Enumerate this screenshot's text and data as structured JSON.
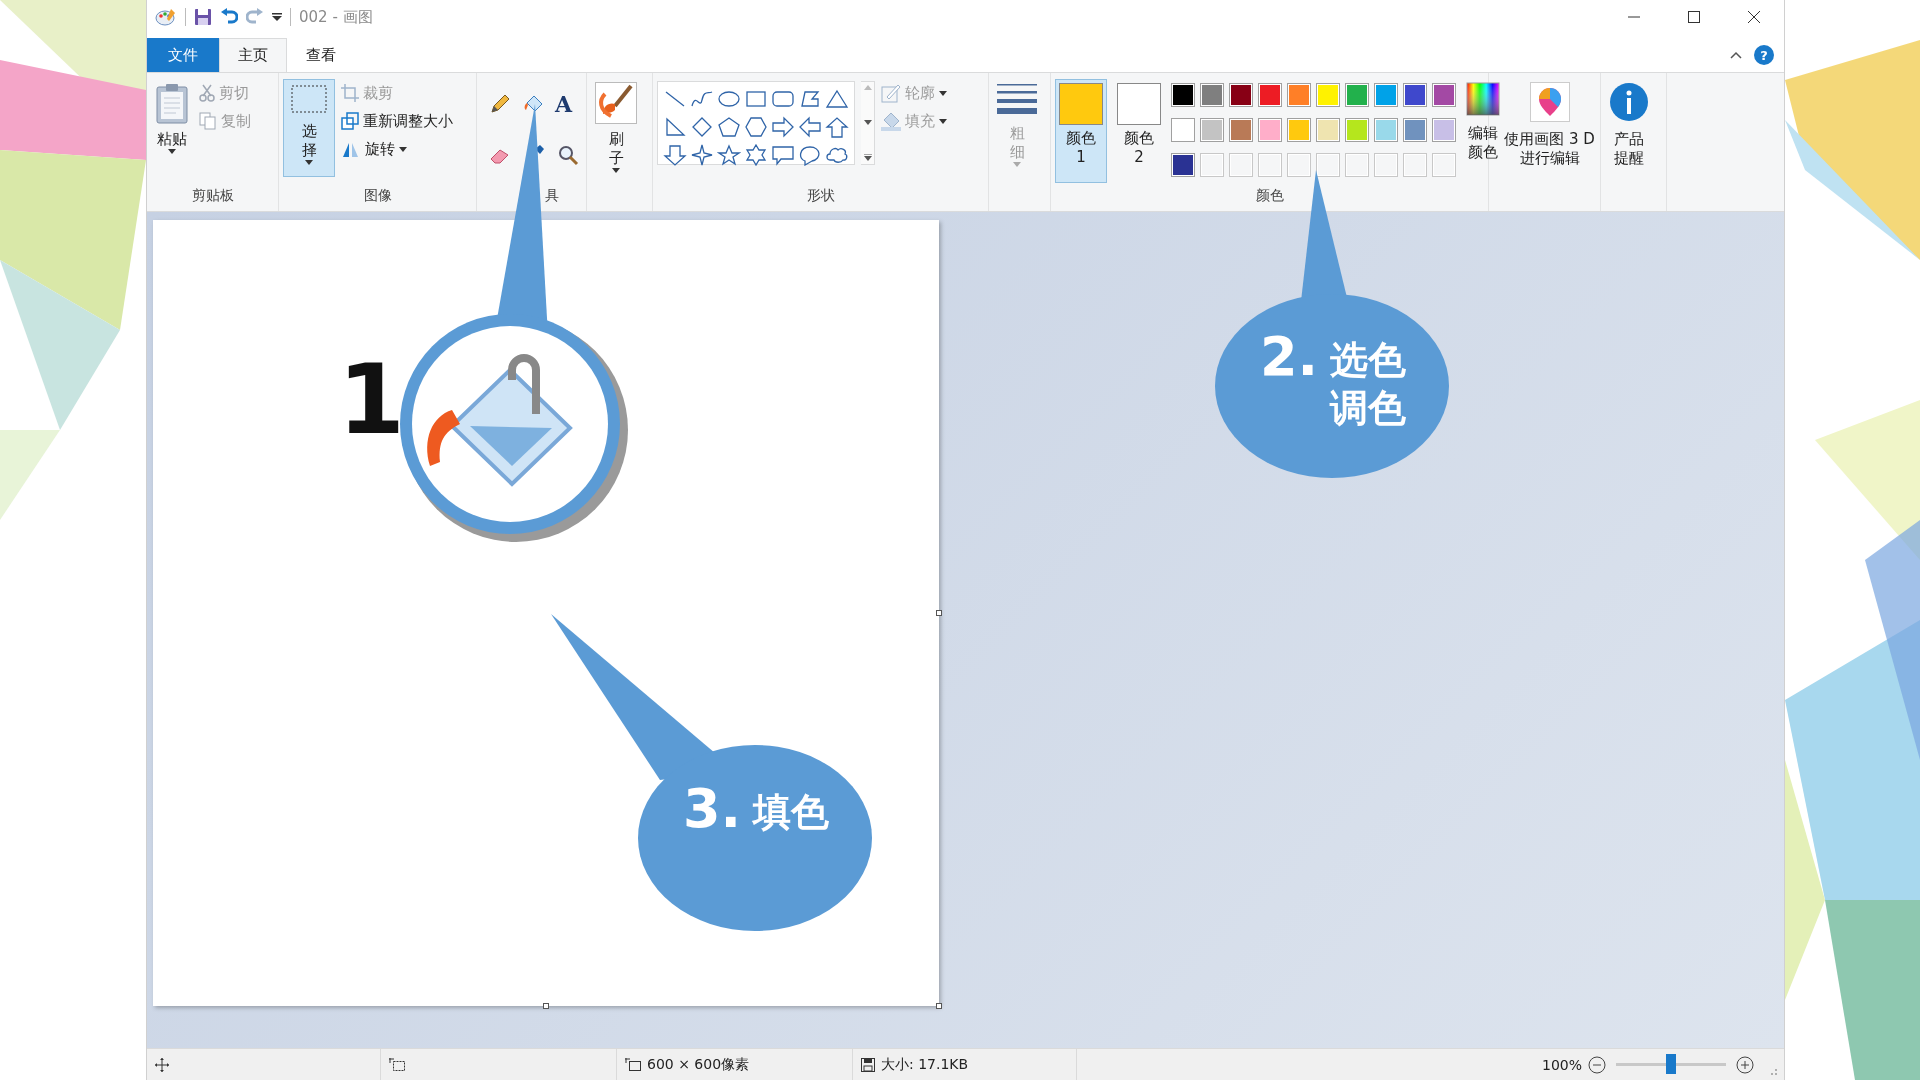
{
  "title_bar": {
    "title": "002 - 画图"
  },
  "tabs": [
    {
      "label": "文件",
      "kind": "file",
      "selected": false
    },
    {
      "label": "主页",
      "kind": "tab",
      "selected": true
    },
    {
      "label": "查看",
      "kind": "tab",
      "selected": false
    }
  ],
  "help_button": "?",
  "ribbon": {
    "clipboard": {
      "label": "剪贴板",
      "paste": "粘贴",
      "items": [
        {
          "label": "剪切",
          "disabled": true
        },
        {
          "label": "复制",
          "disabled": true
        }
      ]
    },
    "image": {
      "label": "图像",
      "select": {
        "label": "选择",
        "selected": true
      },
      "items": [
        {
          "label": "裁剪",
          "disabled": true
        },
        {
          "label": "重新调整大小",
          "disabled": false
        },
        {
          "label": "旋转",
          "disabled": false
        }
      ]
    },
    "tools": {
      "label": "具",
      "text_tool": "A"
    },
    "brushes": {
      "label": "刷子"
    },
    "shapes": {
      "label": "形状",
      "items": [
        {
          "label": "轮廓",
          "disabled": true
        },
        {
          "label": "填充",
          "disabled": true
        }
      ]
    },
    "size": {
      "label": "粗细",
      "disabled": true
    },
    "colors": {
      "label": "颜色",
      "slots": [
        {
          "label": "颜色 1",
          "color": "#ffc90e",
          "selected": true
        },
        {
          "label": "颜色 2",
          "color": "#ffffff",
          "selected": false
        }
      ],
      "palette": [
        {
          "kind": "swatch",
          "color": "#000000"
        },
        {
          "kind": "swatch",
          "color": "#7f7f7f"
        },
        {
          "kind": "swatch",
          "color": "#880015"
        },
        {
          "kind": "swatch",
          "color": "#ed1c24"
        },
        {
          "kind": "swatch",
          "color": "#ff7f27"
        },
        {
          "kind": "swatch",
          "color": "#fff200"
        },
        {
          "kind": "swatch",
          "color": "#22b14c"
        },
        {
          "kind": "swatch",
          "color": "#00a2e8"
        },
        {
          "kind": "swatch",
          "color": "#3f48cc"
        },
        {
          "kind": "swatch",
          "color": "#a349a4"
        },
        {
          "kind": "swatch",
          "color": "#ffffff"
        },
        {
          "kind": "swatch",
          "color": "#c3c3c3"
        },
        {
          "kind": "swatch",
          "color": "#b97a57"
        },
        {
          "kind": "swatch",
          "color": "#ffaec9"
        },
        {
          "kind": "swatch",
          "color": "#ffc90e"
        },
        {
          "kind": "swatch",
          "color": "#efe4b0"
        },
        {
          "kind": "swatch",
          "color": "#b5e61d"
        },
        {
          "kind": "swatch",
          "color": "#99d9ea"
        },
        {
          "kind": "swatch",
          "color": "#7092be"
        },
        {
          "kind": "swatch",
          "color": "#c8bfe7"
        },
        {
          "kind": "swatch",
          "color": "#2a3293"
        },
        {
          "kind": "empty"
        },
        {
          "kind": "empty"
        },
        {
          "kind": "empty"
        },
        {
          "kind": "empty"
        },
        {
          "kind": "empty"
        },
        {
          "kind": "empty"
        },
        {
          "kind": "empty"
        },
        {
          "kind": "empty"
        },
        {
          "kind": "empty"
        }
      ],
      "edit": "编辑颜色"
    },
    "paint3d": "使用画图 3 D 进行编辑",
    "product": "产品提醒"
  },
  "status_bar": {
    "dimensions": "600 × 600像素",
    "file_size": "大小: 17.1KB",
    "zoom": "100%",
    "zoom_slider": {
      "level": 0.5
    }
  },
  "callouts": [
    {
      "kind": "magnifier",
      "number": "1"
    },
    {
      "kind": "bubble",
      "number": "2.",
      "text": "选色调色"
    },
    {
      "kind": "bubble",
      "number": "3.",
      "text": "填色"
    }
  ]
}
